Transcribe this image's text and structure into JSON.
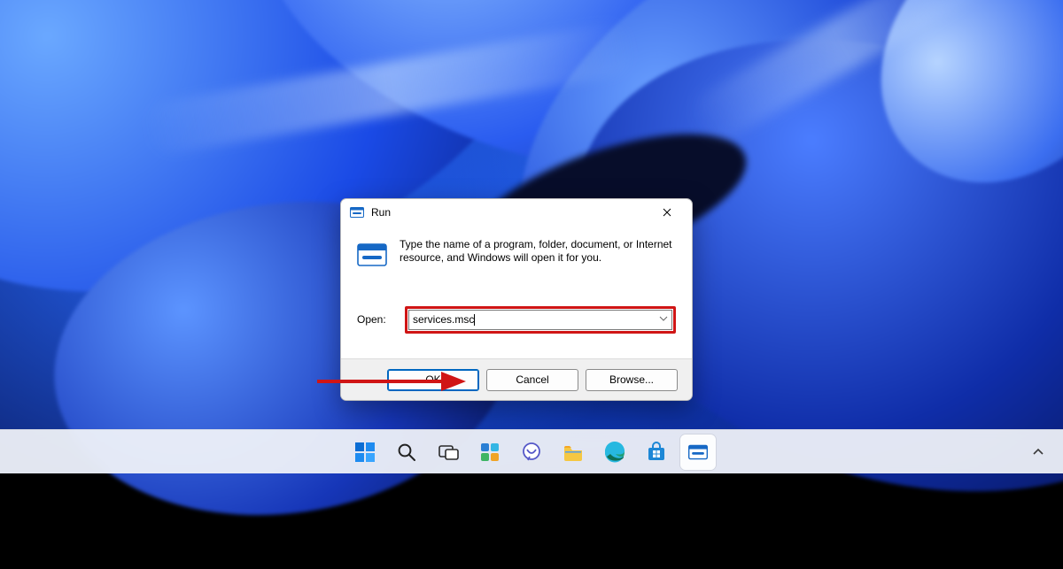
{
  "run_dialog": {
    "title": "Run",
    "prompt": "Type the name of a program, folder, document, or Internet resource, and Windows will open it for you.",
    "open_label": "Open:",
    "command_value": "services.msc",
    "buttons": {
      "ok": "OK",
      "cancel": "Cancel",
      "browse": "Browse..."
    }
  },
  "taskbar": {
    "items": [
      {
        "name": "start",
        "label": "Start"
      },
      {
        "name": "search",
        "label": "Search"
      },
      {
        "name": "task-view",
        "label": "Task View"
      },
      {
        "name": "widgets",
        "label": "Widgets"
      },
      {
        "name": "chat",
        "label": "Chat"
      },
      {
        "name": "file-explorer",
        "label": "File Explorer"
      },
      {
        "name": "edge",
        "label": "Microsoft Edge"
      },
      {
        "name": "store",
        "label": "Microsoft Store"
      },
      {
        "name": "run",
        "label": "Run",
        "active": true
      }
    ]
  },
  "annotation": {
    "highlight_target": "open-combobox",
    "arrow_target": "ok-button"
  }
}
